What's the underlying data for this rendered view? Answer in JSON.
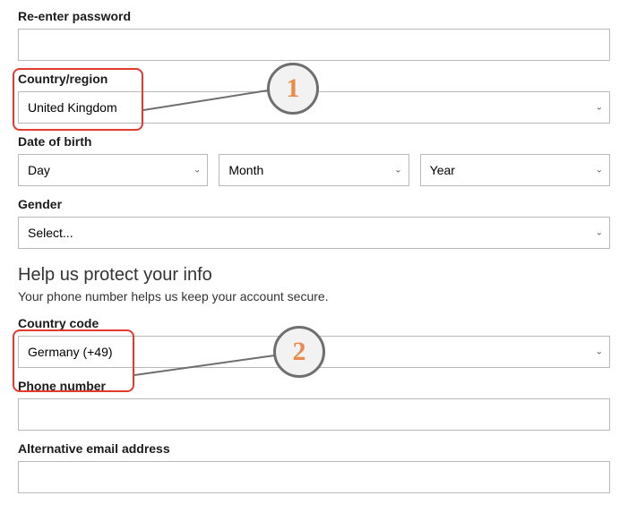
{
  "fields": {
    "reenter_password": {
      "label": "Re-enter password",
      "value": ""
    },
    "country_region": {
      "label": "Country/region",
      "value": "United Kingdom"
    },
    "dob": {
      "label": "Date of birth",
      "day": "Day",
      "month": "Month",
      "year": "Year"
    },
    "gender": {
      "label": "Gender",
      "value": "Select..."
    },
    "country_code": {
      "label": "Country code",
      "value": "Germany (+49)"
    },
    "phone_number": {
      "label": "Phone number",
      "value": ""
    },
    "alt_email": {
      "label": "Alternative email address",
      "value": ""
    }
  },
  "section": {
    "heading": "Help us protect your info",
    "sub": "Your phone number helps us keep your account secure."
  },
  "annotations": {
    "a1": "1",
    "a2": "2"
  }
}
